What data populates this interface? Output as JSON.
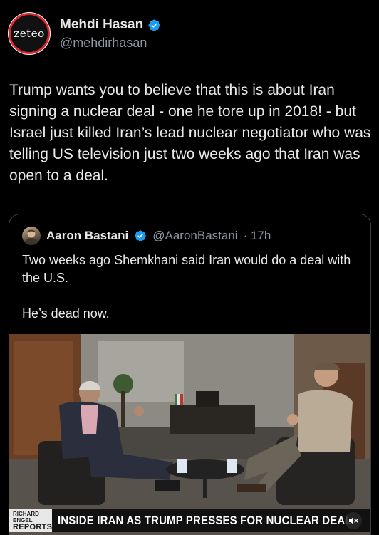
{
  "tweet": {
    "author": {
      "display_name": "Mehdi Hasan",
      "handle": "@mehdirhasan",
      "avatar_text": "zeteo"
    },
    "text": "Trump wants you to believe that this is about Iran signing a nuclear deal - one he tore up in 2018! - but Israel just killed Iran’s lead nuclear negotiator who was telling US television just two weeks ago that Iran was open to a deal."
  },
  "quote": {
    "author": {
      "display_name": "Aaron Bastani",
      "handle": "@AaronBastani",
      "time": "· 17h"
    },
    "text": "Two weeks ago Shemkhani said Iran would do a deal with the U.S.\n\nHe’s dead now.",
    "media": {
      "chyron_brand_top": "RICHARD ENGEL",
      "chyron_brand_bottom": "REPORTS",
      "chyron_headline": "INSIDE IRAN AS TRUMP PRESSES FOR NUCLEAR DEAL",
      "mute_icon": "speaker-muted-icon"
    }
  },
  "colors": {
    "background": "#000000",
    "text_primary": "#e7e9ea",
    "text_secondary": "#8b98a5",
    "verified": "#1d9bf0",
    "card_border": "#3e4144"
  }
}
